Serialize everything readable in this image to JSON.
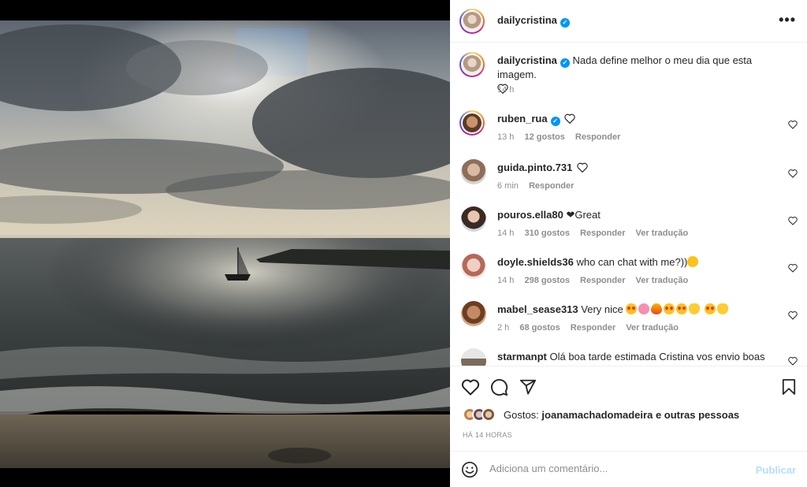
{
  "post": {
    "author": "dailycristina",
    "verified": true,
    "more_label": "•••"
  },
  "caption": {
    "username": "dailycristina",
    "text": "Nada define melhor o meu dia que esta imagem.",
    "time": "14 h"
  },
  "comments": [
    {
      "username": "ruben_rua",
      "verified": true,
      "text": "",
      "emoji": [
        "white-heart"
      ],
      "time": "13 h",
      "likes": "12 gostos",
      "reply": "Responder",
      "translate": ""
    },
    {
      "username": "guida.pinto.731",
      "verified": false,
      "text": "",
      "emoji": [
        "white-heart"
      ],
      "time": "6 min",
      "likes": "",
      "reply": "Responder",
      "translate": ""
    },
    {
      "username": "pouros.ella80",
      "verified": false,
      "text": "❤Great",
      "emoji": [],
      "time": "14 h",
      "likes": "310 gostos",
      "reply": "Responder",
      "translate": "Ver tradução"
    },
    {
      "username": "doyle.shields36",
      "verified": false,
      "text": "who can chat with me?))",
      "emoji": [
        "blush"
      ],
      "time": "14 h",
      "likes": "298 gostos",
      "reply": "Responder",
      "translate": "Ver tradução"
    },
    {
      "username": "mabel_sease313",
      "verified": false,
      "text": "Very nice",
      "emoji": [
        "heart-eyes",
        "flower",
        "fire",
        "heart-eyes",
        "heart-eyes",
        "cat",
        "heart-eyes",
        "cat"
      ],
      "time": "2 h",
      "likes": "68 gostos",
      "reply": "Responder",
      "translate": "Ver tradução"
    },
    {
      "username": "starmanpt",
      "verified": false,
      "text": "Olá boa tarde estimada Cristina vos envio boas",
      "emoji": [],
      "time": "",
      "likes": "",
      "reply": "",
      "translate": ""
    }
  ],
  "actions": {
    "like_icon": "heart-icon",
    "comment_icon": "comment-icon",
    "share_icon": "share-icon",
    "save_icon": "bookmark-icon"
  },
  "likes": {
    "prefix": "Gostos:",
    "user": "joanamachadomadeira",
    "suffix": "e outras pessoas"
  },
  "timestamp": "HÁ 14 HORAS",
  "add_comment": {
    "placeholder": "Adiciona um comentário...",
    "publish_label": "Publicar"
  },
  "colors": {
    "accent": "#0095f6",
    "publish_disabled": "#b2dffc",
    "muted": "#8e8e8e"
  }
}
